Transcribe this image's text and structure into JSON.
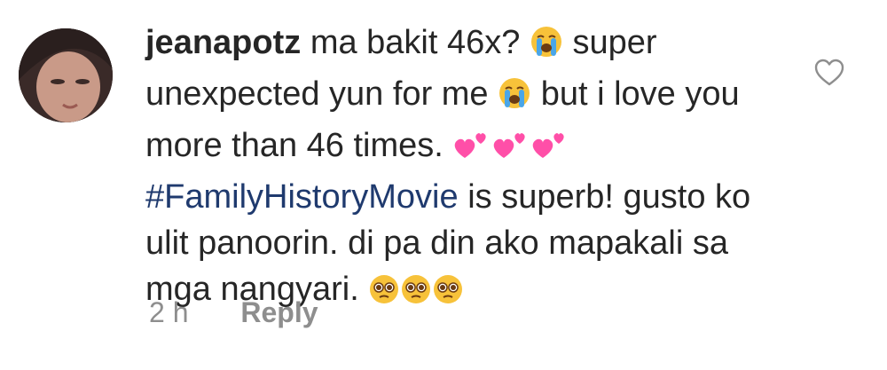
{
  "comment": {
    "username": "jeanapotz",
    "text_1": "ma bakit 46x?",
    "text_2": "super unexpected yun for me",
    "text_3": "but i love you more than 46 times.",
    "hashtag": "#FamilyHistoryMovie",
    "text_4": "is superb! gusto ko ulit panoorin. di pa din ako mapakali sa mga nangyari.",
    "timestamp": "2 h",
    "reply_label": "Reply"
  },
  "icons": {
    "like": "heart-outline-icon",
    "emoji_crying": "loudly-crying-face",
    "emoji_hearts": "two-hearts",
    "emoji_pleading": "pleading-face"
  },
  "colors": {
    "text": "#262626",
    "hashtag": "#1f3a6e",
    "meta": "#8e8e8e",
    "heart_outline": "#8e8e8e",
    "emoji_hearts": "#ff4fa8"
  }
}
